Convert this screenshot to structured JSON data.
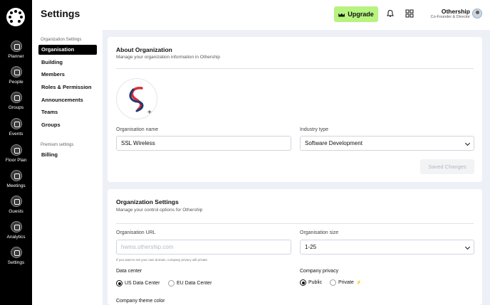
{
  "rail": {
    "items": [
      {
        "label": "Planner",
        "icon": "planner-icon"
      },
      {
        "label": "People",
        "icon": "people-icon"
      },
      {
        "label": "Groups",
        "icon": "groups-icon"
      },
      {
        "label": "Events",
        "icon": "events-icon"
      },
      {
        "label": "Floor Plan",
        "icon": "floor-plan-icon"
      },
      {
        "label": "Meetings",
        "icon": "meetings-icon"
      },
      {
        "label": "Guests",
        "icon": "guests-icon"
      },
      {
        "label": "Analytics",
        "icon": "analytics-icon"
      },
      {
        "label": "Settings",
        "icon": "settings-icon"
      }
    ]
  },
  "header": {
    "title": "Settings",
    "upgrade_label": "Upgrade",
    "user_name": "Othership",
    "user_role": "Co-Founder & Director"
  },
  "nav": {
    "org_caption": "Organization Settings",
    "items": [
      "Organisation",
      "Building",
      "Members",
      "Roles & Permission",
      "Announcements",
      "Teams",
      "Groups"
    ],
    "premium_caption": "Premium settings",
    "premium_items": [
      "Billing"
    ]
  },
  "about": {
    "title": "About Organization",
    "subtitle": "Manage your organization information in Othership",
    "name_label": "Organisation name",
    "name_value": "SSL Wireless",
    "industry_label": "Industry type",
    "industry_value": "Software Development",
    "save_label": "Saved Changes"
  },
  "org_settings": {
    "title": "Organization Settings",
    "subtitle": "Manage your control options for Othership",
    "url_label": "Organisation URL",
    "url_placeholder": "hwms.othership.com",
    "url_hint": "If you want to set your own domain, company privacy will private",
    "size_label": "Organisation size",
    "size_value": "1-25",
    "data_center_label": "Data center",
    "data_center_options": [
      "US Data Center",
      "EU Data Center"
    ],
    "privacy_label": "Company privacy",
    "privacy_options": [
      "Public",
      "Private"
    ],
    "theme_label": "Company theme color"
  },
  "colors": {
    "upgrade_bg": "#b7f37f",
    "main_bg": "#edf0f6",
    "rail_bg": "#000000"
  }
}
